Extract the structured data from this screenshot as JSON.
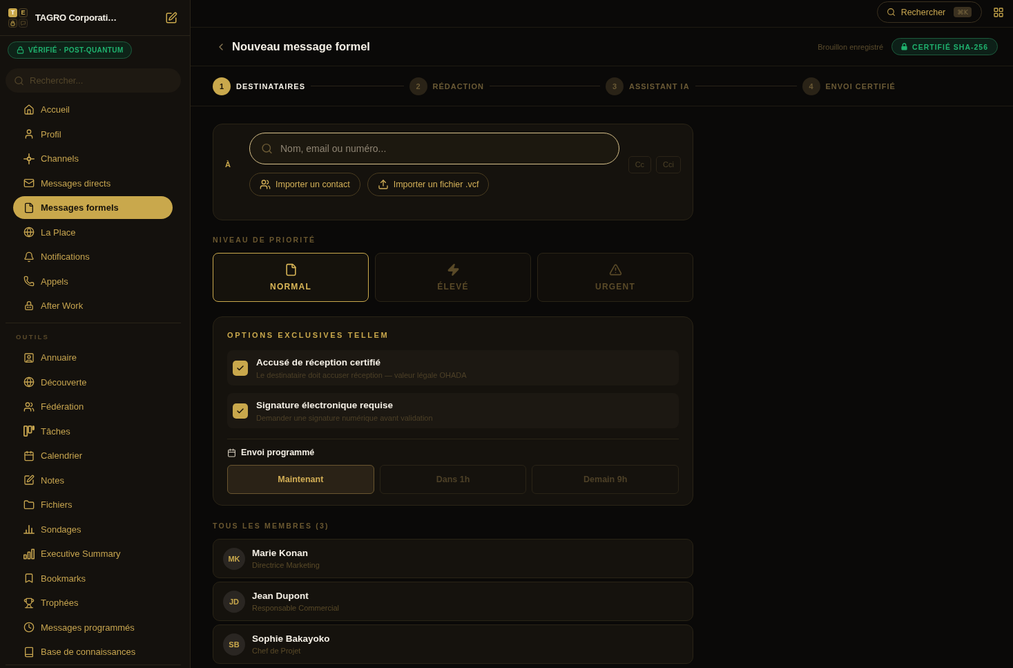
{
  "sidebar": {
    "logo_letters": [
      "T",
      "E"
    ],
    "workspace_name": "TAGRO Corporati…",
    "verified_badge": "VÉRIFIÉ · POST-QUANTUM",
    "search": {
      "placeholder": "Rechercher..."
    },
    "sections": [
      {
        "items": [
          {
            "label": "Accueil",
            "selected": false
          },
          {
            "label": "Profil",
            "selected": false
          },
          {
            "label": "Channels",
            "selected": false
          },
          {
            "label": "Messages directs",
            "selected": false
          },
          {
            "label": "Messages formels",
            "selected": true
          },
          {
            "label": "La Place",
            "selected": false
          },
          {
            "label": "Notifications",
            "selected": false
          },
          {
            "label": "Appels",
            "selected": false
          },
          {
            "label": "After Work",
            "selected": false
          }
        ]
      },
      {
        "heading": "OUTILS",
        "items": [
          {
            "label": "Annuaire",
            "selected": false
          },
          {
            "label": "Découverte",
            "selected": false
          },
          {
            "label": "Fédération",
            "selected": false
          },
          {
            "label": "Tâches",
            "selected": false
          },
          {
            "label": "Calendrier",
            "selected": false
          },
          {
            "label": "Notes",
            "selected": false
          },
          {
            "label": "Fichiers",
            "selected": false
          },
          {
            "label": "Sondages",
            "selected": false
          },
          {
            "label": "Executive Summary",
            "selected": false
          },
          {
            "label": "Bookmarks",
            "selected": false
          },
          {
            "label": "Trophées",
            "selected": false
          },
          {
            "label": "Messages programmés",
            "selected": false
          },
          {
            "label": "Base de connaissances",
            "selected": false
          }
        ]
      }
    ]
  },
  "topbar": {
    "search_label": "Rechercher",
    "shortcut": "⌘K"
  },
  "header": {
    "title": "Nouveau message formel",
    "draft_status": "Brouillon enregistré",
    "certified_badge": "CERTIFIÉ SHA-256"
  },
  "steps": [
    {
      "number": "1",
      "label": "DESTINATAIRES",
      "selected": true
    },
    {
      "number": "2",
      "label": "RÉDACTION",
      "selected": false
    },
    {
      "number": "3",
      "label": "ASSISTANT IA",
      "selected": false
    },
    {
      "number": "4",
      "label": "ENVOI CERTIFIÉ",
      "selected": false
    }
  ],
  "recipients": {
    "to_label": "À",
    "field": {
      "placeholder": "Nom, email ou numéro..."
    },
    "import_buttons": [
      "Importer un contact",
      "Importer un fichier .vcf"
    ],
    "copy_buttons": [
      "Cc",
      "Cci"
    ]
  },
  "priority": {
    "heading": "NIVEAU DE PRIORITÉ",
    "levels": [
      {
        "label": "NORMAL",
        "selected": true
      },
      {
        "label": "ÉLEVÉ",
        "selected": false
      },
      {
        "label": "URGENT",
        "selected": false
      }
    ]
  },
  "options": {
    "heading": "OPTIONS EXCLUSIVES TELLEM",
    "items": [
      {
        "title": "Accusé de réception certifié",
        "description": "Le destinataire doit accuser réception — valeur légale OHADA",
        "checked": true
      },
      {
        "title": "Signature électronique requise",
        "description": "Demander une signature numérique avant validation",
        "checked": true
      }
    ],
    "schedule": {
      "label": "Envoi programmé",
      "choices": [
        {
          "label": "Maintenant",
          "selected": true
        },
        {
          "label": "Dans 1h",
          "selected": false
        },
        {
          "label": "Demain 9h",
          "selected": false
        }
      ]
    }
  },
  "members": {
    "heading": "TOUS LES MEMBRES (3)",
    "items": [
      {
        "initials": "MK",
        "name": "Marie Konan",
        "role": "Directrice Marketing"
      },
      {
        "initials": "JD",
        "name": "Jean Dupont",
        "role": "Responsable Commercial"
      },
      {
        "initials": "SB",
        "name": "Sophie Bakayoko",
        "role": "Chef de Projet"
      }
    ]
  }
}
